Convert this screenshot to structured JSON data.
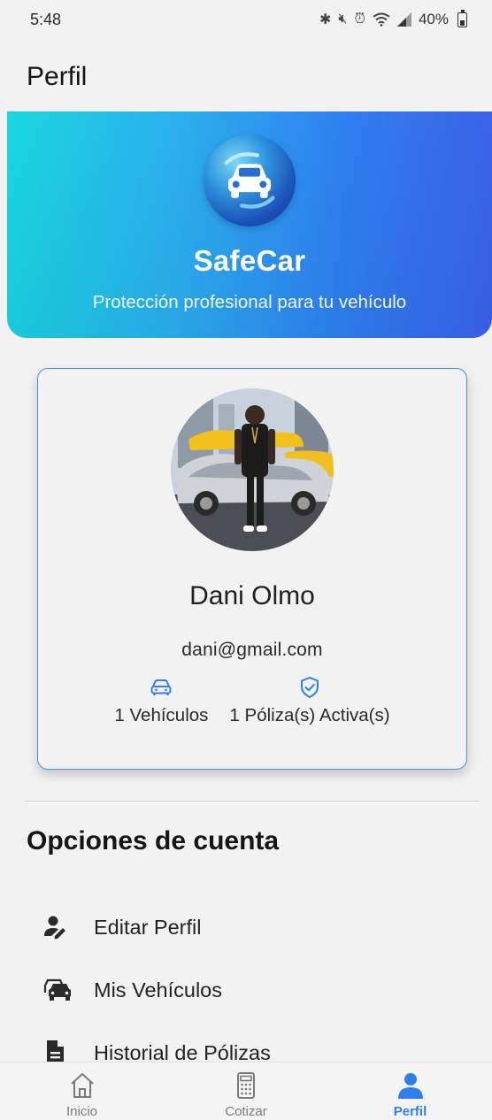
{
  "status_bar": {
    "time": "5:48",
    "battery_text": "40%",
    "icons": [
      "bluetooth-icon",
      "mute-icon",
      "alarm-icon",
      "wifi-icon",
      "signal-icon",
      "battery-icon"
    ]
  },
  "app_bar": {
    "title": "Perfil"
  },
  "hero": {
    "logo_icon": "car-icon",
    "title": "SafeCar",
    "subtitle": "Protección profesional para tu vehículo",
    "colors": [
      "#1ad7e0",
      "#3b62e8"
    ]
  },
  "profile": {
    "name": "Dani Olmo",
    "email": "dani@gmail.com",
    "stats": [
      {
        "icon": "car-icon",
        "label": "1 Vehículos"
      },
      {
        "icon": "shield-check-icon",
        "label": "1 Póliza(s) Activa(s)"
      }
    ]
  },
  "account_options": {
    "title": "Opciones de cuenta",
    "items": [
      {
        "icon": "user-edit-icon",
        "label": "Editar Perfil"
      },
      {
        "icon": "cars-icon",
        "label": "Mis Vehículos"
      },
      {
        "icon": "document-icon",
        "label": "Historial de Pólizas"
      }
    ]
  },
  "bottom_nav": {
    "items": [
      {
        "icon": "home-icon",
        "label": "Inicio",
        "active": false
      },
      {
        "icon": "calculator-icon",
        "label": "Cotizar",
        "active": false
      },
      {
        "icon": "person-icon",
        "label": "Perfil",
        "active": true
      }
    ],
    "active_color": "#2f7ef0"
  }
}
